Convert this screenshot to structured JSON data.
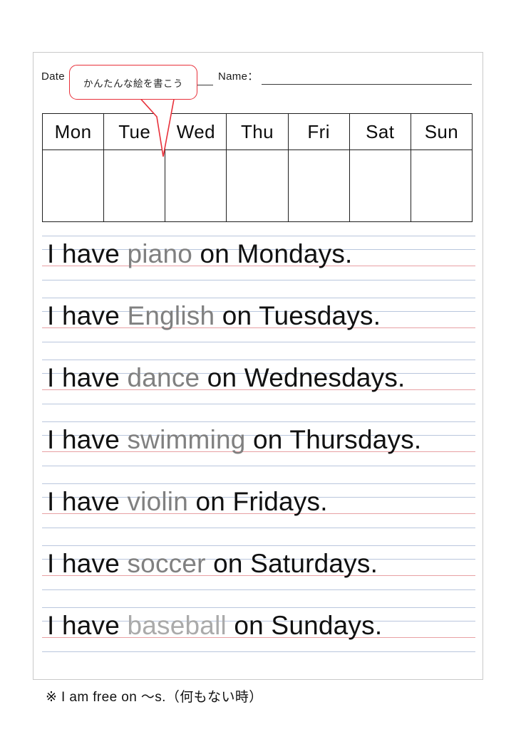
{
  "page": {
    "accent_red": "#e8303a",
    "guide_blue": "#b9c6dd",
    "guide_red": "#e8a0a4",
    "subject_gray": "#808080",
    "subject_gray_faint": "#aaaaaa"
  },
  "header": {
    "date_label": "Date",
    "name_label": "Name：",
    "date_value": "",
    "name_value": ""
  },
  "callout": {
    "text": "かんたんな絵を書こう"
  },
  "weekday_table": {
    "headers": [
      "Mon",
      "Tue",
      "Wed",
      "Thu",
      "Fri",
      "Sat",
      "Sun"
    ],
    "cells": [
      "",
      "",
      "",
      "",
      "",
      "",
      ""
    ]
  },
  "sentences": [
    {
      "prefix": "I have ",
      "subject": "piano",
      "suffix": " on Mondays.",
      "faint": false
    },
    {
      "prefix": "I have ",
      "subject": "English",
      "suffix": " on Tuesdays.",
      "faint": false
    },
    {
      "prefix": "I have ",
      "subject": "dance",
      "suffix": " on Wednesdays.",
      "faint": false
    },
    {
      "prefix": "I have ",
      "subject": "swimming",
      "suffix": " on Thursdays.",
      "faint": false
    },
    {
      "prefix": "I have ",
      "subject": "violin",
      "suffix": " on Fridays.",
      "faint": false
    },
    {
      "prefix": "I have ",
      "subject": "soccer",
      "suffix": " on Saturdays.",
      "faint": false
    },
    {
      "prefix": "I have ",
      "subject": "baseball",
      "suffix": " on Sundays.",
      "faint": true
    }
  ],
  "footer": {
    "note": "※ I am free on 〜s.（何もない時）"
  }
}
